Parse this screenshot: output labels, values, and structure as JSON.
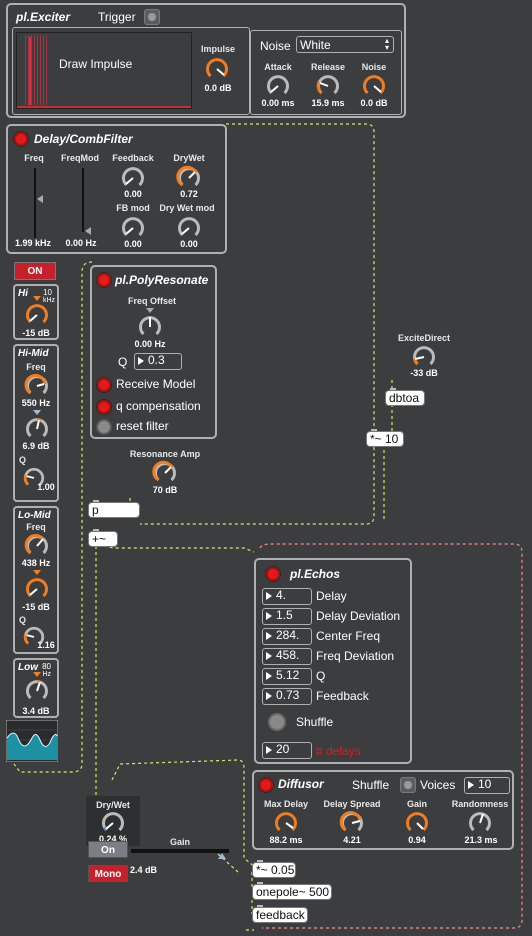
{
  "exciter": {
    "title": "pl.Exciter",
    "trigger": "Trigger",
    "draw": "Draw Impulse",
    "impulse_label": "Impulse",
    "impulse_val": "0.0 dB",
    "noise_label": "Noise",
    "noise_type": "White",
    "attack_label": "Attack",
    "attack_val": "0.00 ms",
    "release_label": "Release",
    "release_val": "15.9 ms",
    "noise2_label": "Noise",
    "noise2_val": "0.0 dB"
  },
  "delay": {
    "title": "Delay/CombFilter",
    "freq_label": "Freq",
    "freq_val": "1.99 kHz",
    "freqmod_label": "FreqMod",
    "freqmod_val": "0.00 Hz",
    "feedback_label": "Feedback",
    "feedback_val": "0.00",
    "drywet_label": "DryWet",
    "drywet_val": "0.72",
    "fbmod_label": "FB mod",
    "fbmod_val": "0.00",
    "drywetmod_label": "Dry Wet mod",
    "drywetmod_val": "0.00"
  },
  "eq": {
    "on": "ON",
    "hi_title": "Hi",
    "hi_unit1": "10",
    "hi_unit2": "kHz",
    "hi_val": "-15 dB",
    "himid_title": "Hi-Mid",
    "himid_freq_label": "Freq",
    "himid_freq": "550 Hz",
    "himid_gain": "6.9 dB",
    "himid_q_label": "Q",
    "himid_q": "1.00",
    "lomid_title": "Lo-Mid",
    "lomid_freq_label": "Freq",
    "lomid_freq": "438 Hz",
    "lomid_gain": "-15 dB",
    "lomid_q_label": "Q",
    "lomid_q": "1.16",
    "low_title": "Low",
    "low_unit1": "80",
    "low_unit2": "Hz",
    "low_val": "3.4 dB"
  },
  "poly": {
    "title": "pl.PolyResonate",
    "freqoffset_label": "Freq Offset",
    "freqoffset_val": "0.00 Hz",
    "q_label": "Q",
    "q_val": "0.3",
    "receive": "Receive Model",
    "qcomp": "q compensation",
    "reset": "reset filter"
  },
  "resamp": {
    "label": "Resonance Amp",
    "val": "70 dB"
  },
  "excite": {
    "label": "ExciteDirect",
    "val": "-33 dB"
  },
  "objects": {
    "dbtoa": "dbtoa",
    "times10": "*~ 10",
    "p": "p",
    "plus": "+~",
    "times005": "*~ 0.05",
    "onepole": "onepole~ 500",
    "feedback": "feedback"
  },
  "echos": {
    "title": "pl.Echos",
    "rows": [
      {
        "val": "4.",
        "label": "Delay"
      },
      {
        "val": "1.5",
        "label": "Delay Deviation"
      },
      {
        "val": "284.",
        "label": "Center Freq"
      },
      {
        "val": "458.",
        "label": "Freq Deviation"
      },
      {
        "val": "5.12",
        "label": "Q"
      },
      {
        "val": "0.73",
        "label": "Feedback"
      }
    ],
    "shuffle": "Shuffle",
    "count": "20",
    "delays": "# delays"
  },
  "diffusor": {
    "title": "Diffusor",
    "shuffle": "Shuffle",
    "voices_label": "Voices",
    "voices": "10",
    "maxdelay_label": "Max Delay",
    "maxdelay_val": "88.2 ms",
    "spread_label": "Delay Spread",
    "spread_val": "4.21",
    "gain_label": "Gain",
    "gain_val": "0.94",
    "rand_label": "Randomness",
    "rand_val": "21.3 ms"
  },
  "out": {
    "drywet_label": "Dry/Wet",
    "drywet_val": "0.24 %",
    "on": "On",
    "mono": "Mono",
    "gain_label": "Gain",
    "gain_val": "2.4 dB"
  },
  "colors": {
    "accent": "#f07d1f",
    "bg": "#3c3d3f",
    "led": "#e41a1a",
    "cable": "#d9e86a",
    "cable_red": "#ff7a7a",
    "spectrum": "#1aa3b8"
  }
}
